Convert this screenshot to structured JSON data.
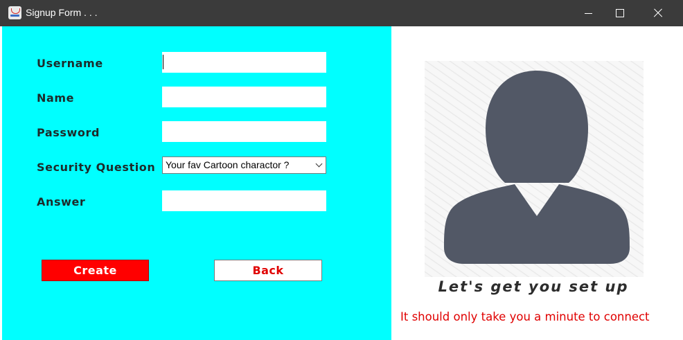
{
  "window": {
    "title": "Signup Form . . .",
    "icon": "java-cup-icon"
  },
  "form": {
    "username_label": "Username",
    "name_label": "Name",
    "password_label": "Password",
    "security_question_label": "Security Question",
    "answer_label": "Answer",
    "username_value": "",
    "name_value": "",
    "password_value": "",
    "answer_value": "",
    "security_question_selected": "Your fav Cartoon charactor ?"
  },
  "buttons": {
    "create_label": "Create",
    "back_label": "Back"
  },
  "side": {
    "avatar_icon": "user-silhouette-icon",
    "tagline": "Let's get you set up",
    "subline": "It should only take you a minute to connect"
  },
  "colors": {
    "left_panel_bg": "#00ffff",
    "create_button_bg": "#ff0000",
    "back_button_text": "#e00000",
    "subline_text": "#e00000",
    "avatar_fill": "#525866",
    "titlebar_bg": "#3b3b3b"
  }
}
